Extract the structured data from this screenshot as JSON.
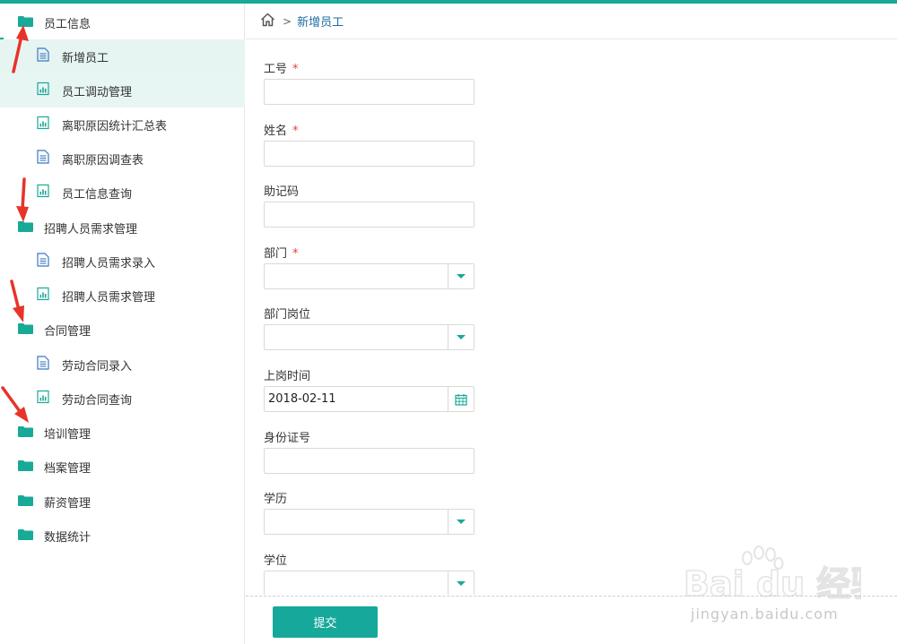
{
  "colors": {
    "accent": "#19a997",
    "link": "#1c6ea5",
    "required": "#e23b3b"
  },
  "sidebar": {
    "items": [
      {
        "type": "group",
        "icon": "folder-icon",
        "label": "员工信息"
      },
      {
        "type": "child",
        "icon": "document-icon",
        "label": "新增员工",
        "active": true
      },
      {
        "type": "child",
        "icon": "report-icon",
        "label": "员工调动管理"
      },
      {
        "type": "child",
        "icon": "report-icon",
        "label": "离职原因统计汇总表"
      },
      {
        "type": "child",
        "icon": "document-icon",
        "label": "离职原因调查表"
      },
      {
        "type": "child",
        "icon": "report-icon",
        "label": "员工信息查询"
      },
      {
        "type": "group",
        "icon": "folder-icon",
        "label": "招聘人员需求管理"
      },
      {
        "type": "child",
        "icon": "document-icon",
        "label": "招聘人员需求录入"
      },
      {
        "type": "child",
        "icon": "report-icon",
        "label": "招聘人员需求管理"
      },
      {
        "type": "group",
        "icon": "folder-icon",
        "label": "合同管理"
      },
      {
        "type": "child",
        "icon": "document-icon",
        "label": "劳动合同录入"
      },
      {
        "type": "child",
        "icon": "report-icon",
        "label": "劳动合同查询"
      },
      {
        "type": "group",
        "icon": "folder-icon",
        "label": "培训管理"
      },
      {
        "type": "group",
        "icon": "folder-icon",
        "label": "档案管理"
      },
      {
        "type": "group",
        "icon": "folder-icon",
        "label": "薪资管理"
      },
      {
        "type": "group",
        "icon": "folder-icon",
        "label": "数据统计"
      }
    ]
  },
  "breadcrumb": {
    "separator": ">",
    "current": "新增员工"
  },
  "form": {
    "required_mark": "*",
    "fields": [
      {
        "label": "工号",
        "required": true,
        "kind": "text",
        "value": ""
      },
      {
        "label": "姓名",
        "required": true,
        "kind": "text",
        "value": ""
      },
      {
        "label": "助记码",
        "required": false,
        "kind": "text",
        "value": ""
      },
      {
        "label": "部门",
        "required": true,
        "kind": "select",
        "value": ""
      },
      {
        "label": "部门岗位",
        "required": false,
        "kind": "select",
        "value": ""
      },
      {
        "label": "上岗时间",
        "required": false,
        "kind": "date",
        "value": "2018-02-11"
      },
      {
        "label": "身份证号",
        "required": false,
        "kind": "text",
        "value": ""
      },
      {
        "label": "学历",
        "required": false,
        "kind": "select",
        "value": ""
      },
      {
        "label": "学位",
        "required": false,
        "kind": "select",
        "value": ""
      }
    ]
  },
  "footer": {
    "submit_label": "提交"
  },
  "watermark": {
    "logo_text": "Bai du 经验",
    "url_text": "jingyan.baidu.com"
  }
}
